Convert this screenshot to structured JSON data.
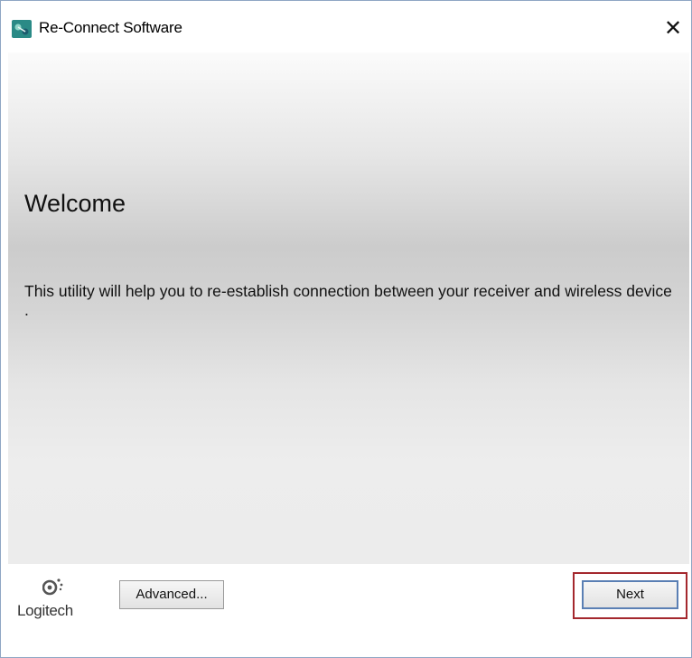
{
  "window": {
    "title": "Re-Connect Software",
    "close_symbol": "✕"
  },
  "main": {
    "heading": "Welcome",
    "description": "This utility will help you to re-establish connection between your receiver and wireless device ."
  },
  "footer": {
    "brand": "Logitech",
    "advanced_label": "Advanced...",
    "next_label": "Next"
  },
  "colors": {
    "highlight": "#a4282e",
    "focus_border": "#5a7fb4"
  }
}
